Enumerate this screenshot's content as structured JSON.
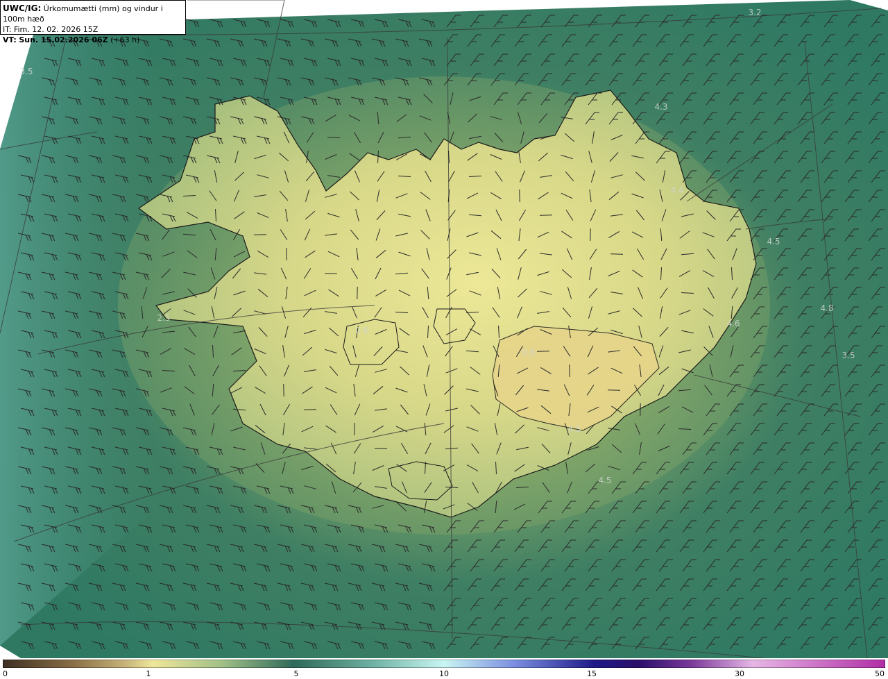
{
  "header": {
    "model": "UWC/IG:",
    "description": "Úrkomumætti (mm) og vindur i 100m hæð",
    "it_label": "IT: ",
    "it_time": "Fim. 12. 02. 2026 15Z",
    "vt_label": "VT:",
    "vt_time": "Sun. 15.02.2026 06Z",
    "vt_offset": "(+63 h)"
  },
  "map": {
    "variable": "precipitable water (mm)",
    "overlay": "wind barbs at 100 m",
    "value_labels": [
      "3.2",
      "3.5",
      "4.3",
      "4.4",
      "4.5",
      "4.8",
      "4.6",
      "3.5",
      "4.5",
      "2.5",
      "0.6",
      "4.5",
      "0.6"
    ]
  },
  "colorbar": {
    "ticks": [
      "0",
      "1",
      "5",
      "10",
      "15",
      "30",
      "50"
    ],
    "colors": [
      "#3e2f22",
      "#8a6f46",
      "#c8b57a",
      "#efe79a",
      "#9fbf86",
      "#2e6a5a",
      "#6fb2a3",
      "#c9f6f3",
      "#7b8ee0",
      "#1f1a88",
      "#2a0f6a",
      "#7a3a9a",
      "#e6b7e5",
      "#b02ea6"
    ]
  }
}
